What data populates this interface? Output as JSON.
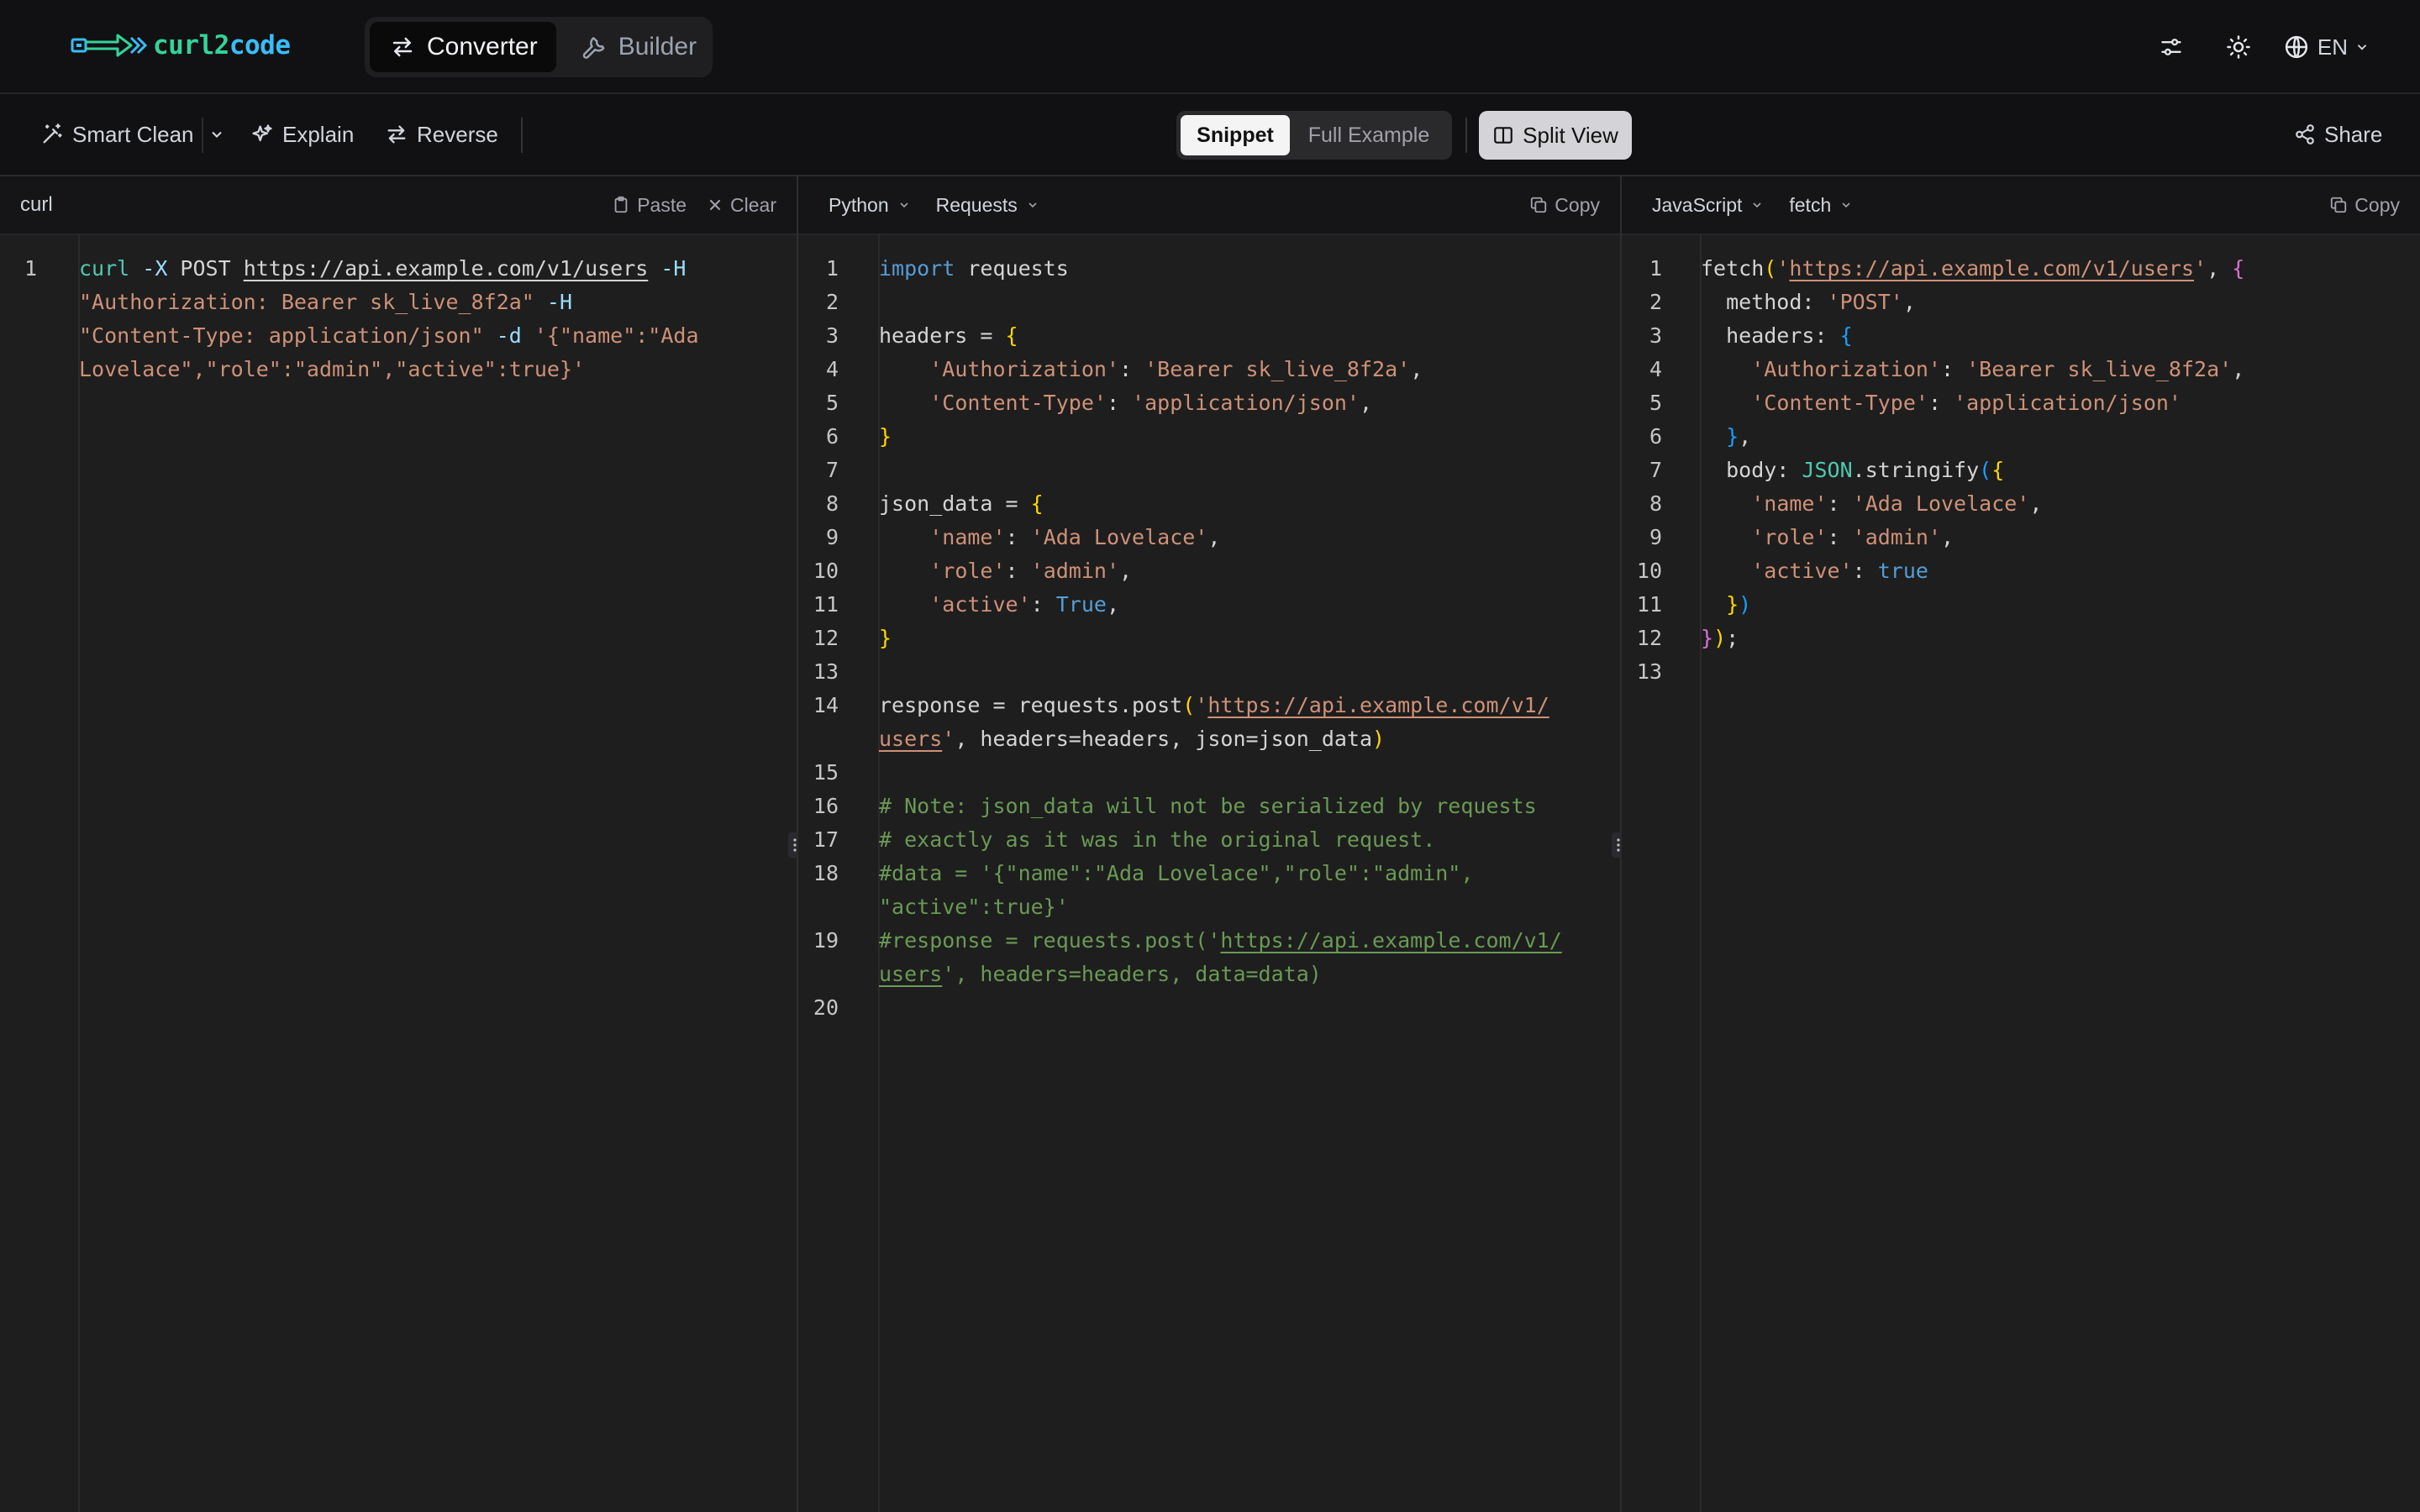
{
  "app": {
    "logo_part1": "curl",
    "logo_part2": "2",
    "logo_part3": "code"
  },
  "modes": [
    {
      "label": "Converter",
      "icon": "arrows-swap-icon",
      "active": true
    },
    {
      "label": "Builder",
      "icon": "wrench-icon",
      "active": false
    }
  ],
  "top_actions": {
    "settings_icon": "sliders-icon",
    "theme_icon": "sun-icon",
    "language": "EN"
  },
  "toolbar": {
    "smart_clean": "Smart Clean",
    "explain": "Explain",
    "reverse": "Reverse",
    "output_modes": [
      {
        "label": "Snippet",
        "active": true
      },
      {
        "label": "Full Example",
        "active": false
      }
    ],
    "split_view": "Split View",
    "share": "Share"
  },
  "input_pane": {
    "title": "curl",
    "paste": "Paste",
    "clear": "Clear"
  },
  "python_pane": {
    "language": "Python",
    "library": "Requests",
    "copy": "Copy"
  },
  "js_pane": {
    "language": "JavaScript",
    "library": "fetch",
    "copy": "Copy"
  },
  "curl_code": {
    "line_number": "1",
    "rows": [
      [
        "curl",
        " -X",
        " POST ",
        "https://api.example.com/v1/users",
        " -H"
      ],
      [
        "\"Authorization: Bearer sk_live_8f2a\"",
        " -H"
      ],
      [
        "\"Content-Type: application/json\"",
        " -d",
        " '{\"name\":\"Ada"
      ],
      [
        "Lovelace\",\"role\":\"admin\",\"active\":true}'"
      ]
    ]
  },
  "python_code": {
    "line_numbers": [
      "1",
      "2",
      "3",
      "4",
      "5",
      "6",
      "7",
      "8",
      "9",
      "10",
      "11",
      "12",
      "13",
      "14",
      "15",
      "16",
      "17",
      "18",
      "19",
      "20"
    ],
    "l1": [
      "import",
      " requests"
    ],
    "l3": [
      "headers = ",
      "{"
    ],
    "l4": [
      "    ",
      "'Authorization'",
      ": ",
      "'Bearer sk_live_8f2a'",
      ","
    ],
    "l5": [
      "    ",
      "'Content-Type'",
      ": ",
      "'application/json'",
      ","
    ],
    "l6": [
      "}"
    ],
    "l8": [
      "json_data = ",
      "{"
    ],
    "l9": [
      "    ",
      "'name'",
      ": ",
      "'Ada Lovelace'",
      ","
    ],
    "l10": [
      "    ",
      "'role'",
      ": ",
      "'admin'",
      ","
    ],
    "l11": [
      "    ",
      "'active'",
      ": ",
      "True",
      ","
    ],
    "l12": [
      "}"
    ],
    "l14a": [
      "response = requests.post",
      "(",
      "'",
      "https://api.example.com/v1/"
    ],
    "l14b": [
      "users",
      "'",
      ", headers=headers, json=json_data",
      ")"
    ],
    "l16": [
      "# Note: json_data will not be serialized by requests"
    ],
    "l17": [
      "# exactly as it was in the original request."
    ],
    "l18a": [
      "#data = '{\"name\":\"Ada Lovelace\",\"role\":\"admin\","
    ],
    "l18b": [
      "\"active\":true}'"
    ],
    "l19a": [
      "#response = requests.post('",
      "https://api.example.com/v1/"
    ],
    "l19b": [
      "users",
      "', headers=headers, data=data)"
    ]
  },
  "js_code": {
    "line_numbers": [
      "1",
      "2",
      "3",
      "4",
      "5",
      "6",
      "7",
      "8",
      "9",
      "10",
      "11",
      "12",
      "13"
    ],
    "l1": [
      "fetch",
      "(",
      "'",
      "https://api.example.com/v1/users",
      "'",
      ", ",
      "{"
    ],
    "l2": [
      "  method: ",
      "'POST'",
      ","
    ],
    "l3": [
      "  headers: ",
      "{"
    ],
    "l4": [
      "    ",
      "'Authorization'",
      ": ",
      "'Bearer sk_live_8f2a'",
      ","
    ],
    "l5": [
      "    ",
      "'Content-Type'",
      ": ",
      "'application/json'"
    ],
    "l6": [
      "  ",
      "}",
      ","
    ],
    "l7": [
      "  body: ",
      "JSON",
      ".stringify",
      "(",
      "{"
    ],
    "l8": [
      "    ",
      "'name'",
      ": ",
      "'Ada Lovelace'",
      ","
    ],
    "l9": [
      "    ",
      "'role'",
      ": ",
      "'admin'",
      ","
    ],
    "l10": [
      "    ",
      "'active'",
      ": ",
      "true"
    ],
    "l11": [
      "  ",
      "}",
      ")"
    ],
    "l12": [
      "}",
      ")",
      ";"
    ]
  },
  "colors": {
    "keyword": "#569cd6",
    "string": "#ce9178",
    "comment": "#6a9955",
    "bracket_gold": "#ffd700",
    "bracket_blue": "#179fff",
    "bracket_purple": "#da70d6",
    "class": "#4ec9b0"
  }
}
